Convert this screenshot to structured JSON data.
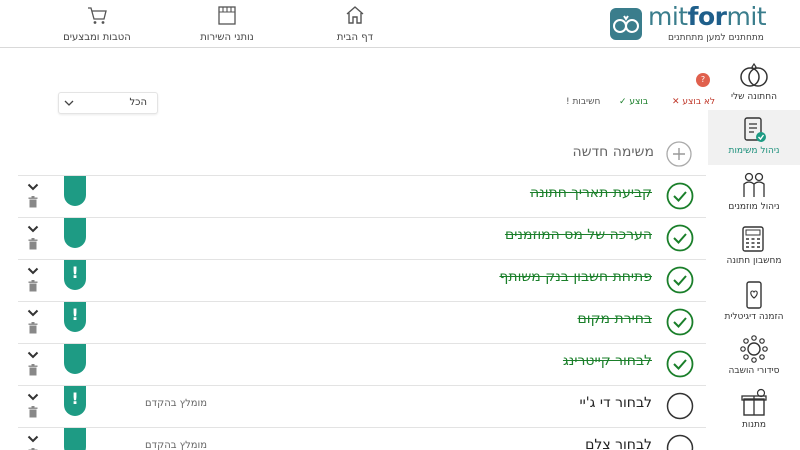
{
  "brand": {
    "name_prefix": "mit",
    "name_mid": "for",
    "name_suffix": "mit",
    "tagline": "מתחתנים למען מתחתנים",
    "color": "#3a7d8c"
  },
  "nav": {
    "home": "דף הבית",
    "vendors": "נותני השירות",
    "deals": "הטבות ומבצעים"
  },
  "sidebar": {
    "items": [
      {
        "label": "החתונה שלי",
        "icon": "rings-icon"
      },
      {
        "label": "ניהול משימות",
        "icon": "checklist-icon"
      },
      {
        "label": "ניהול מוזמנים",
        "icon": "guests-icon"
      },
      {
        "label": "מחשבון חתונה",
        "icon": "calculator-icon"
      },
      {
        "label": "הזמנה דיגיטלית",
        "icon": "phone-invite-icon"
      },
      {
        "label": "סידורי הושבה",
        "icon": "seating-icon"
      },
      {
        "label": "מתנות",
        "icon": "gift-icon"
      }
    ]
  },
  "filters": {
    "not_done": "לא בוצע",
    "done": "בוצע",
    "important": "חשיבות",
    "help_badge": "?",
    "select_value": "הכל"
  },
  "new_task": {
    "label": "משימה חדשה"
  },
  "tasks": [
    {
      "title": "קביעת תאריך חתונה",
      "done": true,
      "important": false,
      "note": ""
    },
    {
      "title": "הערכה של מס המוזמנים",
      "done": true,
      "important": false,
      "note": ""
    },
    {
      "title": "פתיחת חשבון בנק משותף",
      "done": true,
      "important": true,
      "note": ""
    },
    {
      "title": "בחירת מקום",
      "done": true,
      "important": true,
      "note": ""
    },
    {
      "title": "לבחור קייטרינג",
      "done": true,
      "important": false,
      "note": ""
    },
    {
      "title": "לבחור די ג'יי",
      "done": false,
      "important": true,
      "note": "מומלץ בהקדם"
    },
    {
      "title": "לבחור צלם",
      "done": false,
      "important": false,
      "note": "מומלץ בהקדם"
    }
  ],
  "colors": {
    "accent": "#1e9b84",
    "done_text": "#1a7f2a",
    "alert": "#e0604d"
  }
}
